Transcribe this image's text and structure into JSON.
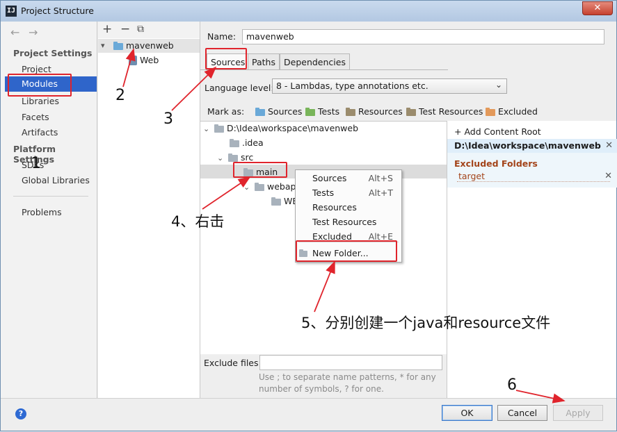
{
  "window": {
    "title": "Project Structure",
    "close_label": "✕"
  },
  "nav": {
    "back_icon": "arrow-left-icon",
    "forward_icon": "arrow-right-icon",
    "project_settings_heading": "Project Settings",
    "project_items": [
      "Project",
      "Modules",
      "Libraries",
      "Facets",
      "Artifacts"
    ],
    "selected_item": "Modules",
    "platform_settings_heading": "Platform Settings",
    "platform_items": [
      "SDKs",
      "Global Libraries"
    ],
    "problems": "Problems"
  },
  "module_tree": {
    "toolbar": [
      "+",
      "−",
      "⧉"
    ],
    "root": "mavenweb",
    "child": "Web"
  },
  "module_editor": {
    "name_label": "Name:",
    "name_value": "mavenweb",
    "tabs": [
      "Sources",
      "Paths",
      "Dependencies"
    ],
    "active_tab": "Sources",
    "language_level_label": "Language level:",
    "language_level_value": "8 - Lambdas, type annotations etc.",
    "mark_as_label": "Mark as:",
    "mark_as_buttons": [
      "Sources",
      "Tests",
      "Resources",
      "Test Resources",
      "Excluded"
    ],
    "tree": {
      "root": "D:\\Idea\\workspace\\mavenweb",
      "idea": ".idea",
      "src": "src",
      "main": "main",
      "webapp": "webap",
      "web_inf": "WE"
    },
    "exclude_files_label": "Exclude files:",
    "exclude_files_value": "",
    "exclude_hint": "Use ; to separate name patterns, * for any number of symbols, ? for one."
  },
  "content_root": {
    "add_label": "Add Content Root",
    "path": "D:\\Idea\\workspace\\mavenweb",
    "excluded_heading": "Excluded Folders",
    "excluded_items": [
      "target"
    ]
  },
  "context_menu": {
    "items": [
      {
        "label": "Sources",
        "shortcut": "Alt+S"
      },
      {
        "label": "Tests",
        "shortcut": "Alt+T"
      },
      {
        "label": "Resources",
        "shortcut": ""
      },
      {
        "label": "Test Resources",
        "shortcut": ""
      },
      {
        "label": "Excluded",
        "shortcut": "Alt+E"
      }
    ],
    "new_folder": "New Folder..."
  },
  "buttons": {
    "help": "?",
    "ok": "OK",
    "cancel": "Cancel",
    "apply": "Apply"
  },
  "annotations": {
    "n1": "1",
    "n2": "2",
    "n3": "3",
    "step4": "4、右击",
    "step5": "5、分别创建一个java和resource文件",
    "n6": "6",
    "color": "#e0242c"
  }
}
